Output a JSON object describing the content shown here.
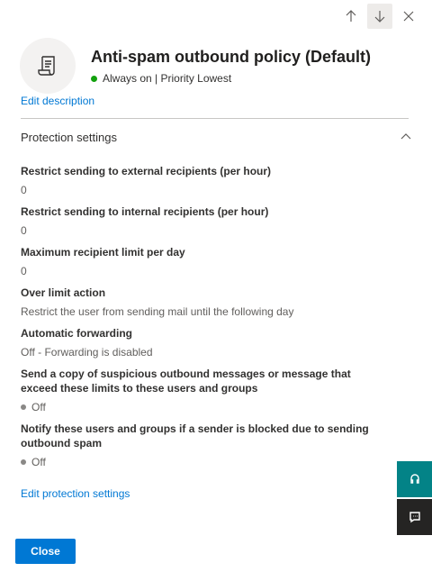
{
  "icons": {
    "nav_up": "arrow-up-icon",
    "nav_down": "arrow-down-icon",
    "close": "close-icon",
    "policy": "policy-scroll-icon",
    "collapse": "chevron-up-icon",
    "help": "help-agent-icon",
    "feedback": "feedback-icon"
  },
  "colors": {
    "accent": "#0078d4",
    "status_on": "#13a10e",
    "status_off": "#8a8886",
    "help_button": "#038387",
    "feedback_button": "#252423"
  },
  "header": {
    "title": "Anti-spam outbound policy (Default)",
    "status": "Always on | Priority Lowest"
  },
  "clipped_link": "Edit description",
  "section": {
    "title": "Protection settings",
    "fields": [
      {
        "label": "Restrict sending to external recipients (per hour)",
        "value": "0"
      },
      {
        "label": "Restrict sending to internal recipients (per hour)",
        "value": "0"
      },
      {
        "label": "Maximum recipient limit per day",
        "value": "0"
      },
      {
        "label": "Over limit action",
        "value": "Restrict the user from sending mail until the following day"
      },
      {
        "label": "Automatic forwarding",
        "value": "Off - Forwarding is disabled"
      },
      {
        "label": "Send a copy of suspicious outbound messages or message that exceed these limits to these users and groups",
        "value": "Off"
      },
      {
        "label": "Notify these users and groups if a sender is blocked due to sending outbound spam",
        "value": "Off"
      }
    ],
    "edit_link": "Edit protection settings"
  },
  "footer": {
    "close_label": "Close"
  }
}
